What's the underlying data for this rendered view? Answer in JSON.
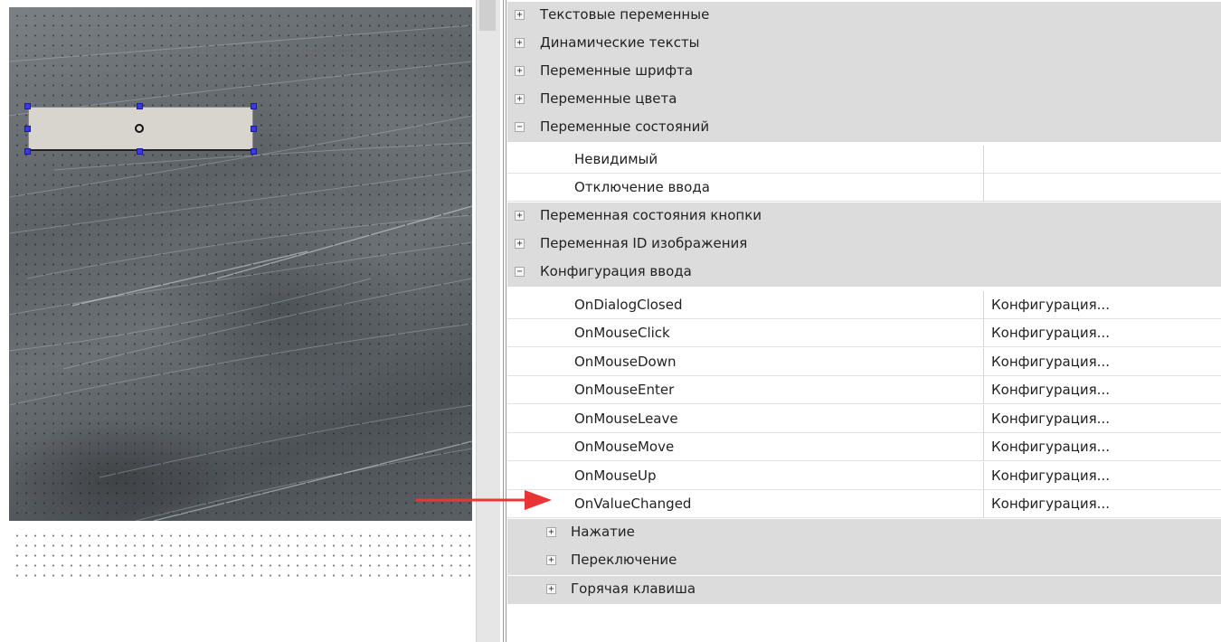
{
  "property_grid": {
    "categories_top": [
      {
        "label": "Текстовые переменные",
        "expander": "+"
      },
      {
        "label": "Динамические тексты",
        "expander": "+"
      },
      {
        "label": "Переменные шрифта",
        "expander": "+"
      },
      {
        "label": "Переменные цвета",
        "expander": "+"
      }
    ],
    "state_vars": {
      "label": "Переменные состояний",
      "expander": "−",
      "items": [
        {
          "name": "Невидимый",
          "value": ""
        },
        {
          "name": "Отключение ввода",
          "value": ""
        }
      ]
    },
    "categories_mid": [
      {
        "label": "Переменная состояния кнопки",
        "expander": "+"
      },
      {
        "label": "Переменная ID изображения",
        "expander": "+"
      }
    ],
    "input_config": {
      "label": "Конфигурация ввода",
      "expander": "−",
      "items": [
        {
          "name": "OnDialogClosed",
          "value": "Конфигурация..."
        },
        {
          "name": "OnMouseClick",
          "value": "Конфигурация..."
        },
        {
          "name": "OnMouseDown",
          "value": "Конфигурация..."
        },
        {
          "name": "OnMouseEnter",
          "value": "Конфигурация..."
        },
        {
          "name": "OnMouseLeave",
          "value": "Конфигурация..."
        },
        {
          "name": "OnMouseMove",
          "value": "Конфигурация..."
        },
        {
          "name": "OnMouseUp",
          "value": "Конфигурация..."
        },
        {
          "name": "OnValueChanged",
          "value": "Конфигурация..."
        }
      ],
      "subcategories": [
        {
          "label": "Нажатие",
          "expander": "+"
        },
        {
          "label": "Переключение",
          "expander": "+"
        },
        {
          "label": "Горячая клавиша",
          "expander": "+"
        }
      ]
    }
  },
  "colors": {
    "category_bg": "#dcdcdc",
    "selection_handle": "#3a3ae0",
    "annotation_arrow": "#e83535"
  },
  "icons": {
    "expand": "plus-box-icon",
    "collapse": "minus-box-icon",
    "annotation": "red-arrow-icon"
  }
}
